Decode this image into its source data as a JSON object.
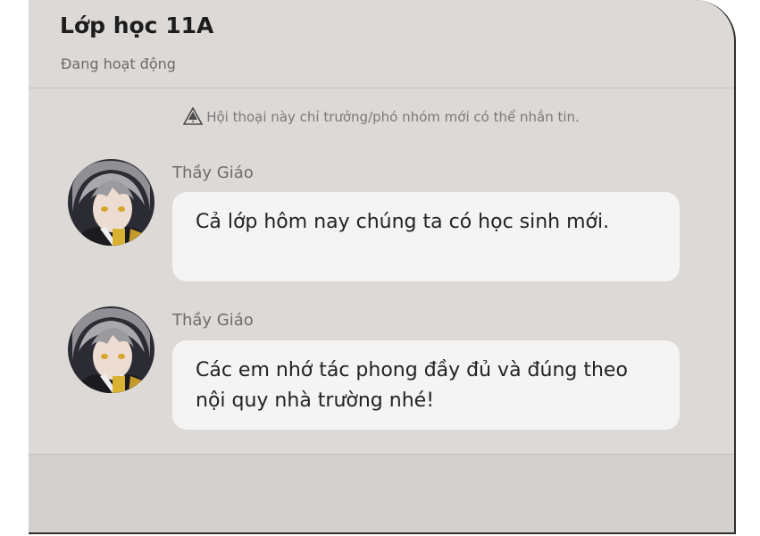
{
  "header": {
    "title": "Lớp học 11A",
    "status": "Đang hoạt động"
  },
  "notice": {
    "icon": "warning-triangle-icon",
    "text": "Hội thoại này chỉ trưởng/phó nhóm mới có thể nhắn tin."
  },
  "messages": [
    {
      "sender": "Thầy Giáo",
      "text": "Cả lớp hôm nay chúng ta có học sinh mới."
    },
    {
      "sender": "Thầy Giáo",
      "text": "Các em nhớ tác phong đầy đủ và đúng theo nội quy nhà trường nhé!"
    }
  ],
  "colors": {
    "panel_bg": "#dcd9d7",
    "bubble_bg": "#f4f4f4",
    "footer_bg": "#d3d0ce"
  }
}
